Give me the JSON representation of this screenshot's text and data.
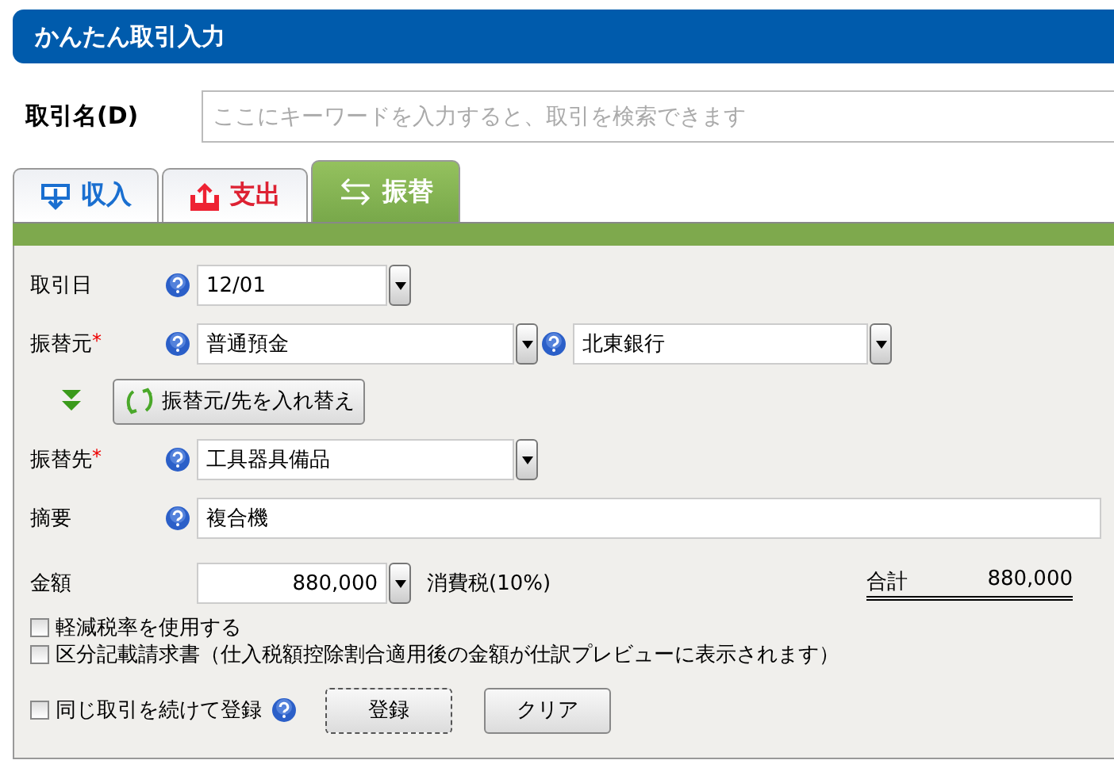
{
  "header": {
    "title": "かんたん取引入力"
  },
  "search": {
    "label": "取引名(D)",
    "placeholder": "ここにキーワードを入力すると、取引を検索できます"
  },
  "tabs": [
    {
      "label": "収入",
      "kind": "income",
      "selected": false
    },
    {
      "label": "支出",
      "kind": "expense",
      "selected": false
    },
    {
      "label": "振替",
      "kind": "transfer",
      "selected": true
    }
  ],
  "form": {
    "date": {
      "label": "取引日",
      "value": "12/01"
    },
    "from": {
      "label": "振替元",
      "mark": "*",
      "value": "普通預金",
      "sub_value": "北東銀行"
    },
    "swap_button": "振替元/先を入れ替え",
    "to": {
      "label": "振替先",
      "mark": "*",
      "value": "工具器具備品"
    },
    "memo": {
      "label": "摘要",
      "value": "複合機"
    },
    "amount": {
      "label": "金額",
      "value": "880,000",
      "tax": "消費税(10%)",
      "total_label": "合計",
      "total": "880,000"
    },
    "options": [
      {
        "label": "軽減税率を使用する",
        "checked": false
      },
      {
        "label": "区分記載請求書（仕入税額控除割合適用後の金額が仕訳プレビューに表示されます）",
        "checked": false
      }
    ],
    "repeat": {
      "label": "同じ取引を続けて登録",
      "checked": false
    },
    "buttons": [
      {
        "label": "登録",
        "focused": true
      },
      {
        "label": "クリア",
        "focused": false
      }
    ]
  }
}
